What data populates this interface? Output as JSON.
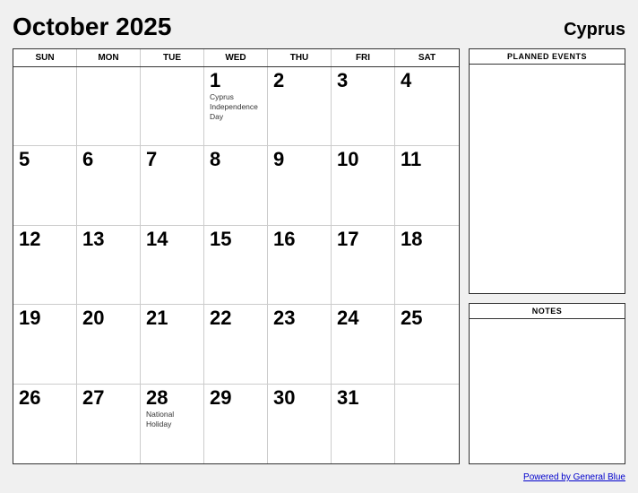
{
  "header": {
    "title": "October 2025",
    "country": "Cyprus"
  },
  "calendar": {
    "day_headers": [
      "SUN",
      "MON",
      "TUE",
      "WED",
      "THU",
      "FRI",
      "SAT"
    ],
    "cells": [
      {
        "day": "",
        "empty": true
      },
      {
        "day": "",
        "empty": true
      },
      {
        "day": "",
        "empty": true
      },
      {
        "day": "1",
        "event": "Cyprus Independence Day"
      },
      {
        "day": "2",
        "event": ""
      },
      {
        "day": "3",
        "event": ""
      },
      {
        "day": "4",
        "event": ""
      },
      {
        "day": "5",
        "event": ""
      },
      {
        "day": "6",
        "event": ""
      },
      {
        "day": "7",
        "event": ""
      },
      {
        "day": "8",
        "event": ""
      },
      {
        "day": "9",
        "event": ""
      },
      {
        "day": "10",
        "event": ""
      },
      {
        "day": "11",
        "event": ""
      },
      {
        "day": "12",
        "event": ""
      },
      {
        "day": "13",
        "event": ""
      },
      {
        "day": "14",
        "event": ""
      },
      {
        "day": "15",
        "event": ""
      },
      {
        "day": "16",
        "event": ""
      },
      {
        "day": "17",
        "event": ""
      },
      {
        "day": "18",
        "event": ""
      },
      {
        "day": "19",
        "event": ""
      },
      {
        "day": "20",
        "event": ""
      },
      {
        "day": "21",
        "event": ""
      },
      {
        "day": "22",
        "event": ""
      },
      {
        "day": "23",
        "event": ""
      },
      {
        "day": "24",
        "event": ""
      },
      {
        "day": "25",
        "event": ""
      },
      {
        "day": "26",
        "event": ""
      },
      {
        "day": "27",
        "event": ""
      },
      {
        "day": "28",
        "event": "National Holiday"
      },
      {
        "day": "29",
        "event": ""
      },
      {
        "day": "30",
        "event": ""
      },
      {
        "day": "31",
        "event": ""
      },
      {
        "day": "",
        "empty": true
      }
    ]
  },
  "sidebar": {
    "planned_events_label": "PLANNED EVENTS",
    "notes_label": "NOTES"
  },
  "footer": {
    "link_text": "Powered by General Blue"
  }
}
